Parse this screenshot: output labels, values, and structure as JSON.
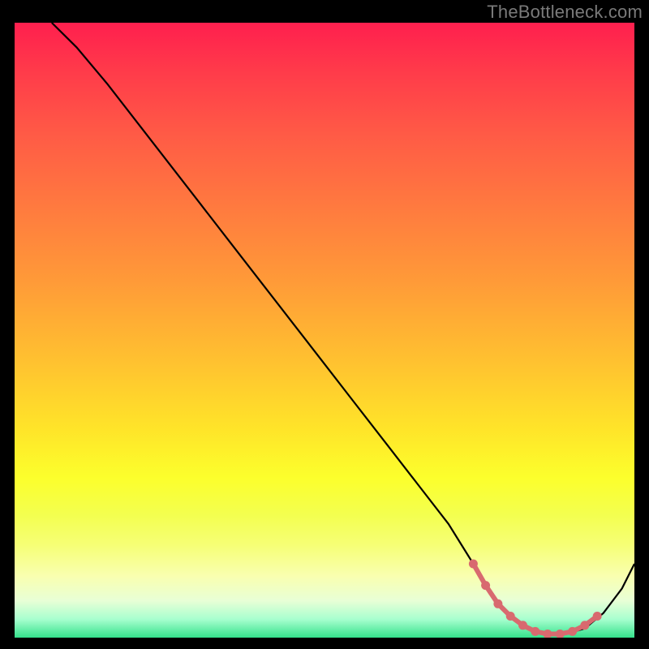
{
  "watermark": "TheBottleneck.com",
  "colors": {
    "background": "#000000",
    "gradient_top": "#ff1f4e",
    "gradient_bottom": "#34e18b",
    "curve": "#000000",
    "markers": "#d86a6f"
  },
  "chart_data": {
    "type": "line",
    "title": "",
    "xlabel": "",
    "ylabel": "",
    "xlim": [
      0,
      100
    ],
    "ylim": [
      0,
      100
    ],
    "series": [
      {
        "name": "bottleneck-curve",
        "x": [
          6,
          10,
          15,
          20,
          25,
          30,
          35,
          40,
          45,
          50,
          55,
          60,
          65,
          70,
          74,
          77,
          80,
          83,
          86,
          89,
          92,
          95,
          98,
          100
        ],
        "y": [
          100,
          96,
          90,
          83.5,
          77,
          70.5,
          64,
          57.5,
          51,
          44.5,
          38,
          31.5,
          25,
          18.5,
          12,
          7,
          3.5,
          1.5,
          0.6,
          0.6,
          1.5,
          4,
          8,
          12
        ]
      }
    ],
    "highlighted_points": {
      "name": "highlight-band",
      "x": [
        74,
        76,
        78,
        80,
        82,
        84,
        86,
        88,
        90,
        92,
        94
      ],
      "y": [
        12,
        8.5,
        5.5,
        3.5,
        2,
        1,
        0.6,
        0.6,
        1,
        2,
        3.5
      ]
    },
    "annotations": []
  }
}
